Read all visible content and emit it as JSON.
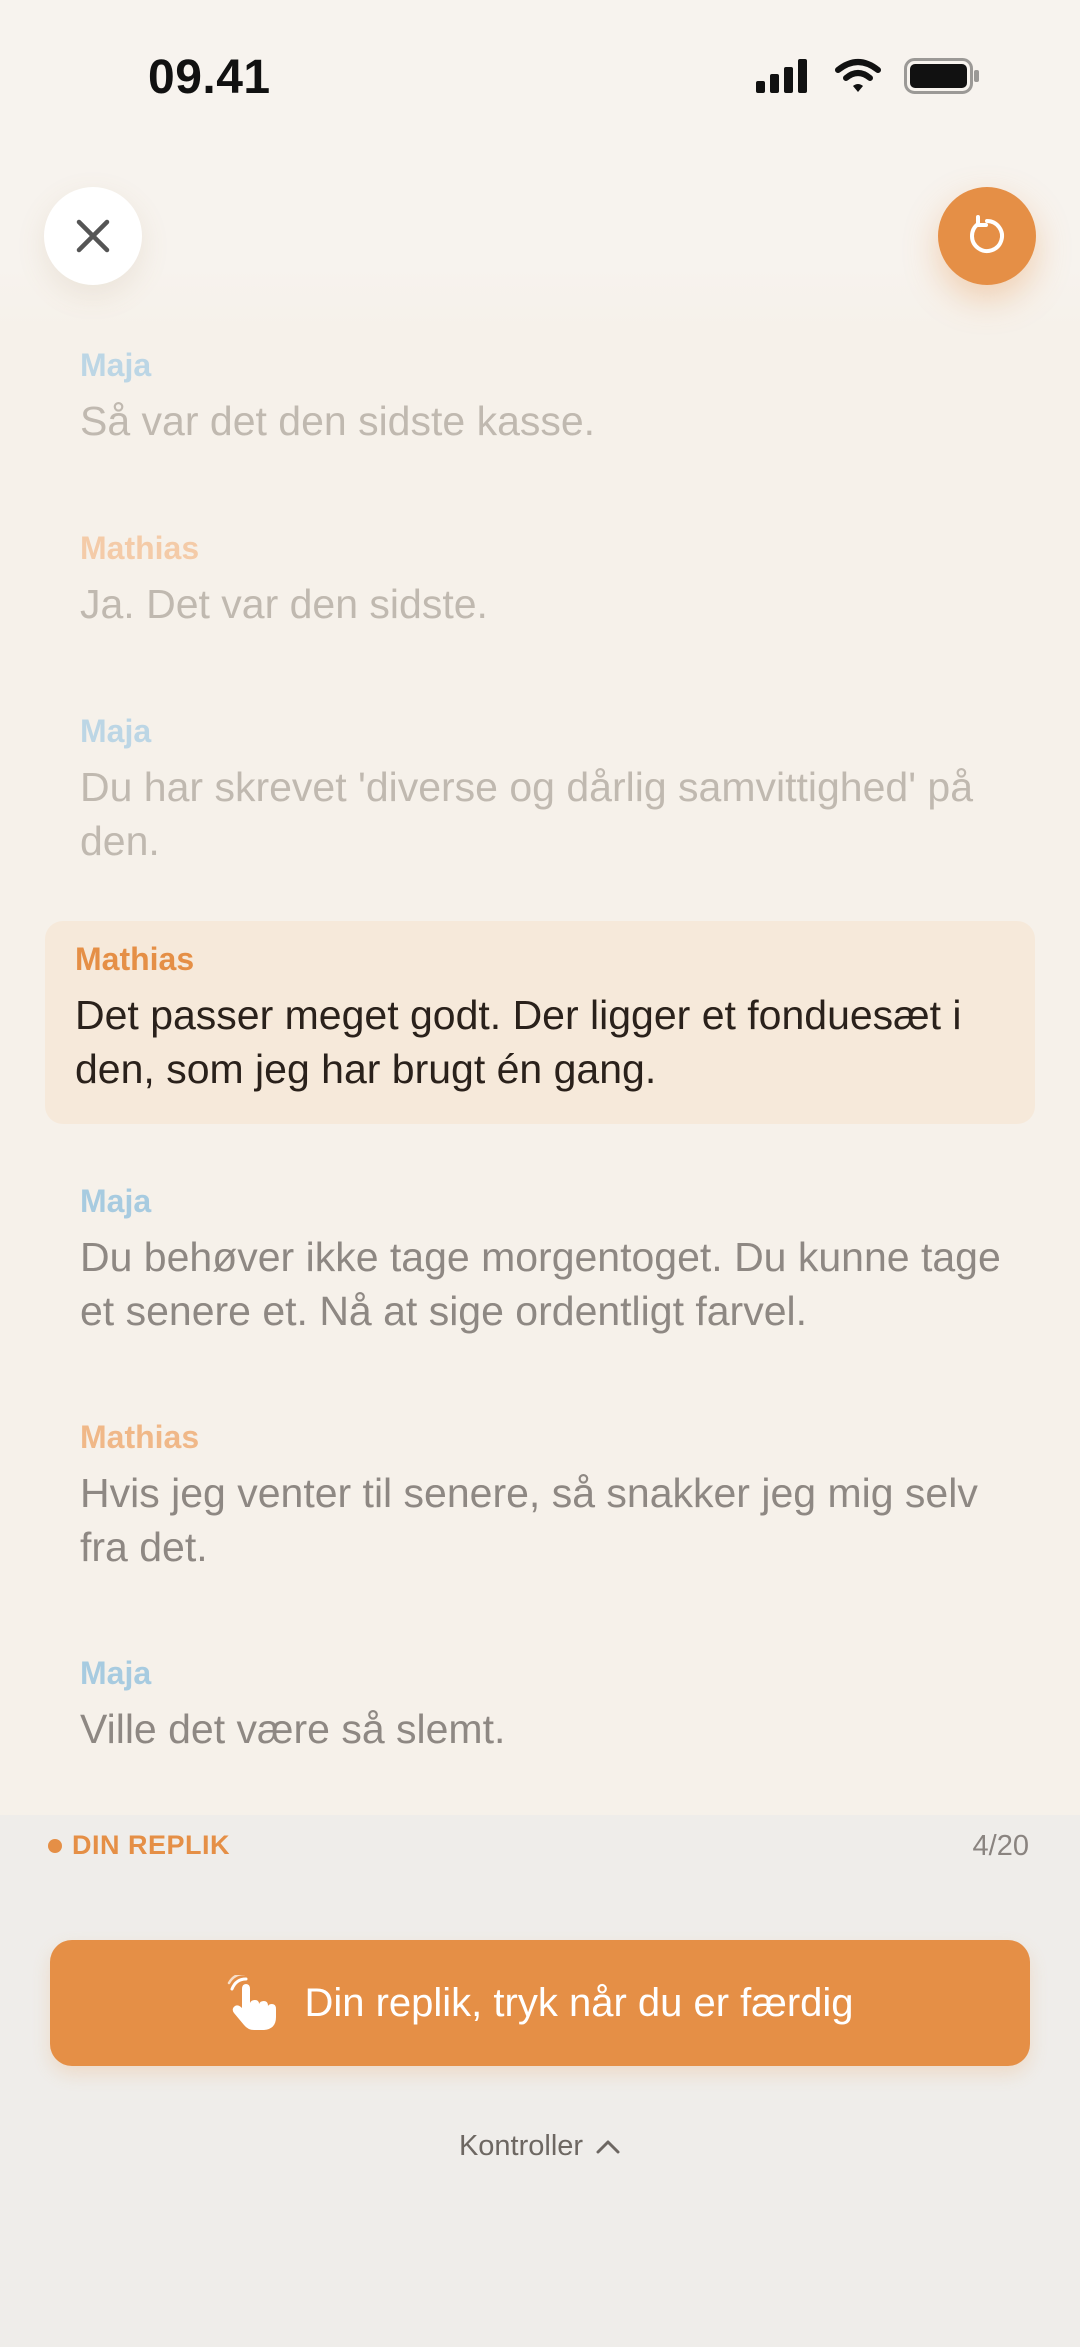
{
  "status_bar": {
    "time": "09.41",
    "icons": [
      "cellular-signal-icon",
      "wifi-icon",
      "battery-icon"
    ]
  },
  "header": {
    "close_icon": "close-icon",
    "restart_icon": "restart-icon"
  },
  "script_lines": [
    {
      "speaker": "Maja",
      "text": "Så var det den sidste kasse.",
      "state": "past"
    },
    {
      "speaker": "Mathias",
      "text": "Ja. Det var den sidste.",
      "state": "past"
    },
    {
      "speaker": "Maja",
      "text": "Du har skrevet 'diverse og dårlig samvittighed' på den.",
      "state": "past"
    },
    {
      "speaker": "Mathias",
      "text": "Det passer meget godt. Der ligger et fonduesæt i den, som jeg har brugt én gang.",
      "state": "current"
    },
    {
      "speaker": "Maja",
      "text": "Du behøver ikke tage morgentoget. Du kunne tage et senere et. Nå at sige ordentligt farvel.",
      "state": "upcoming"
    },
    {
      "speaker": "Mathias",
      "text": "Hvis jeg venter til senere, så snakker jeg mig selv fra det.",
      "state": "upcoming"
    },
    {
      "speaker": "Maja",
      "text": "Ville det være så slemt.",
      "state": "upcoming"
    }
  ],
  "bottom": {
    "your_line_label": "DIN REPLIK",
    "progress": "4/20",
    "main_button_label": "Din replik, tryk når du er færdig",
    "controls_label": "Kontroller"
  },
  "colors": {
    "accent": "#e58f46",
    "maja": "#a7cbe0",
    "mathias": "#f0b888",
    "background": "#f6f1ea"
  }
}
